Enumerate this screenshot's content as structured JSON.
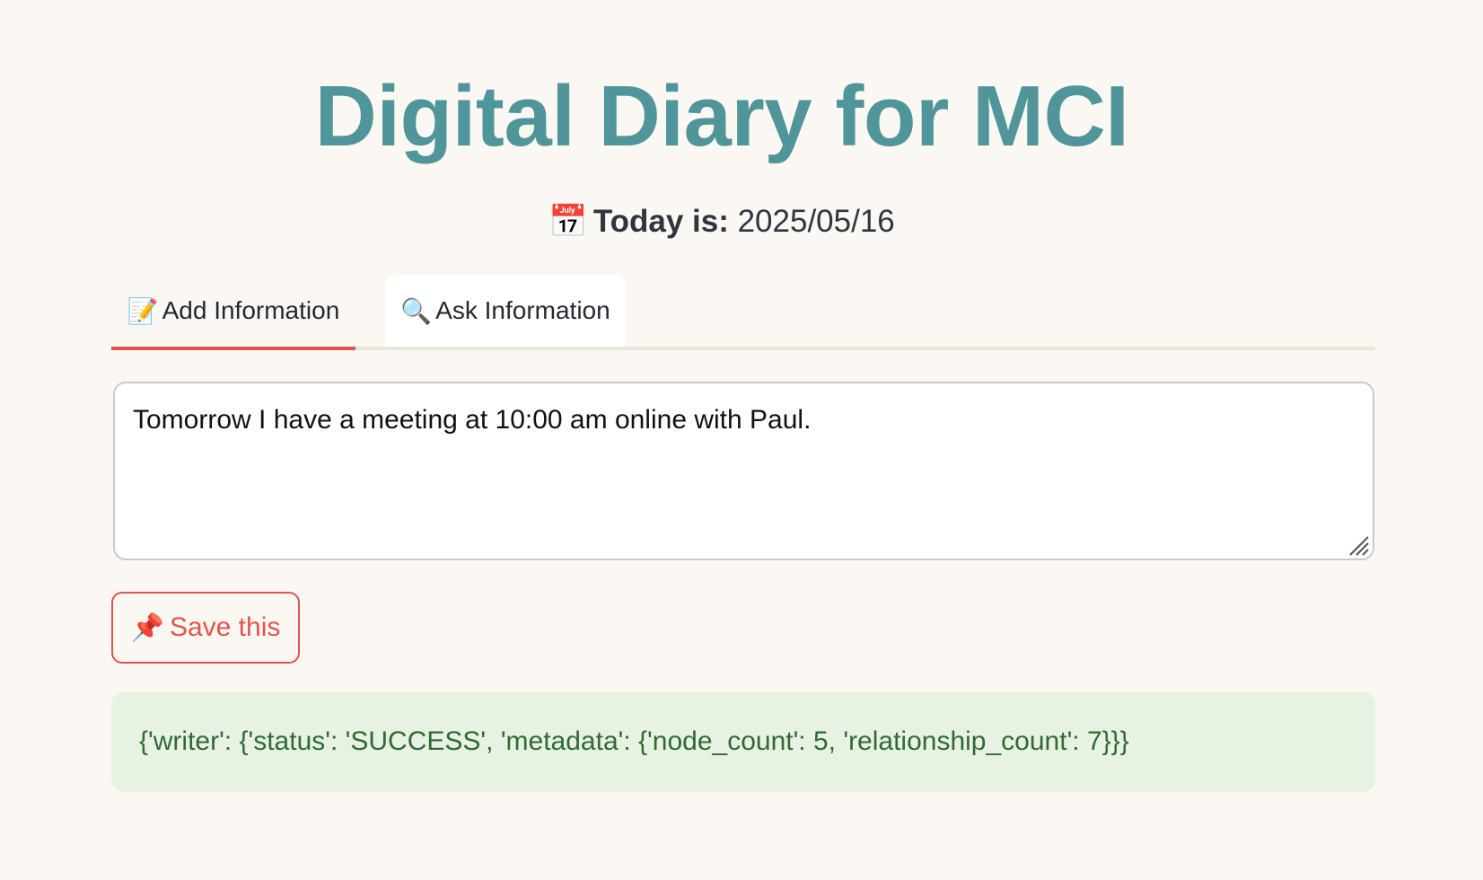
{
  "header": {
    "title": "Digital Diary for MCI",
    "date_icon": "📅",
    "date_label": "Today is:",
    "date_value": "2025/05/16"
  },
  "tabs": [
    {
      "icon": "📝",
      "label": "Add Information",
      "active": true
    },
    {
      "icon": "🔍",
      "label": "Ask Information",
      "active": false
    }
  ],
  "note": {
    "value": "Tomorrow I have a meeting at 10:00 am online with Paul."
  },
  "save_button": {
    "icon": "📌",
    "label": "Save this"
  },
  "result": {
    "text": "{'writer': {'status': 'SUCCESS', 'metadata': {'node_count': 5, 'relationship_count': 7}}}"
  },
  "colors": {
    "title": "#4f9599",
    "accent": "#e4544b",
    "success_bg": "#e8f2e3",
    "success_text": "#2f6a34",
    "page_bg": "#fbf8f3"
  }
}
